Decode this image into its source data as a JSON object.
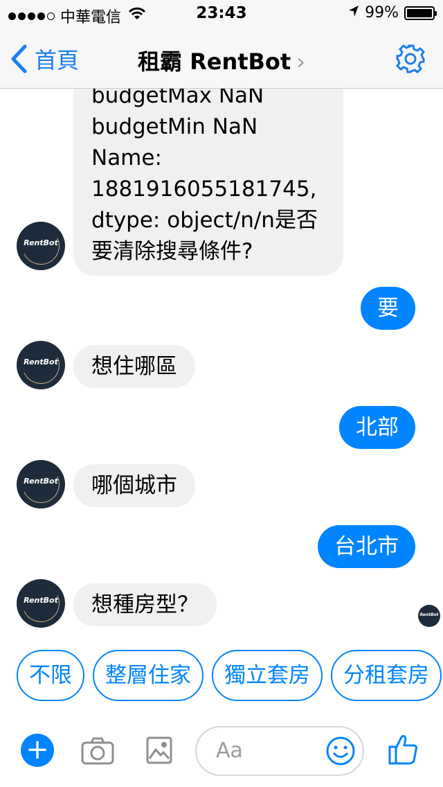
{
  "status_bar": {
    "carrier": "中華電信",
    "time": "23:43",
    "battery": "99%",
    "battery_level": 0.99
  },
  "nav": {
    "back_label": "首頁",
    "title": "租霸 RentBot",
    "title_chevron": "›"
  },
  "bot_avatar_label": "RentBot",
  "messages": {
    "bot_summary": [
      "budgetMax    NaN",
      "budgetMin    NaN",
      "Name:",
      "1881916055181745,",
      "dtype: object/n/n是否",
      "要清除搜尋條件?"
    ],
    "user_1": "要",
    "bot_2": "想住哪區",
    "user_2": "北部",
    "bot_3": "哪個城市",
    "user_3": "台北市",
    "bot_4": "想種房型？"
  },
  "quick_replies": [
    "不限",
    "整層住家",
    "獨立套房",
    "分租套房"
  ],
  "composer": {
    "placeholder": "Aa",
    "plus": "+"
  },
  "colors": {
    "accent": "#0084ff",
    "ios_blue": "#1a7ef0",
    "bot_bubble": "#f0f0f0",
    "avatar_bg": "#1d2b3a"
  }
}
